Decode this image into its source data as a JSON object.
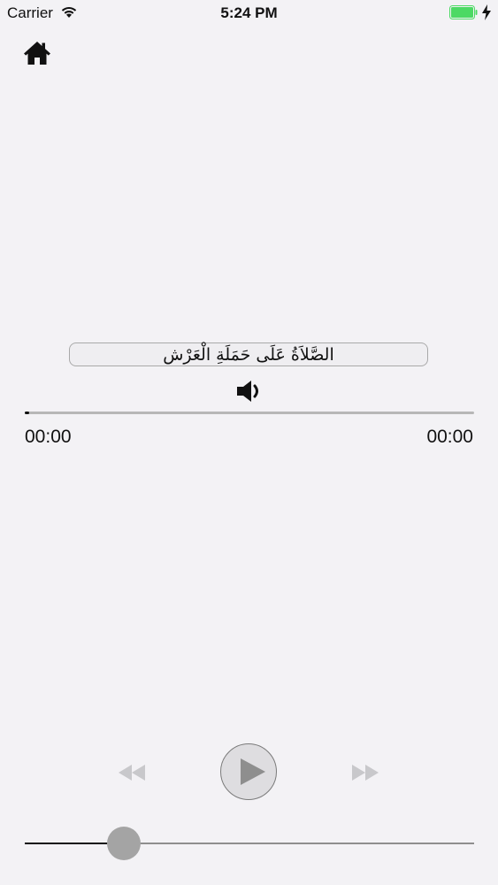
{
  "status_bar": {
    "carrier": "Carrier",
    "time": "5:24 PM",
    "battery_color": "#4cd964"
  },
  "header": {
    "home_icon": "home-icon"
  },
  "player": {
    "title": "الصَّلاَةُ عَلَى حَمَلَةِ الْعَرْش",
    "elapsed": "00:00",
    "total": "00:00",
    "progress_fraction": 0.01,
    "volume_fraction": 0.22
  },
  "controls": {
    "rewind_icon": "rewind-icon",
    "play_icon": "play-icon",
    "forward_icon": "fast-forward-icon",
    "speaker_icon": "speaker-icon"
  },
  "colors": {
    "background": "#f3f2f5",
    "disabled_control": "#c8c8cb",
    "play_fill": "#8e8e8e"
  }
}
